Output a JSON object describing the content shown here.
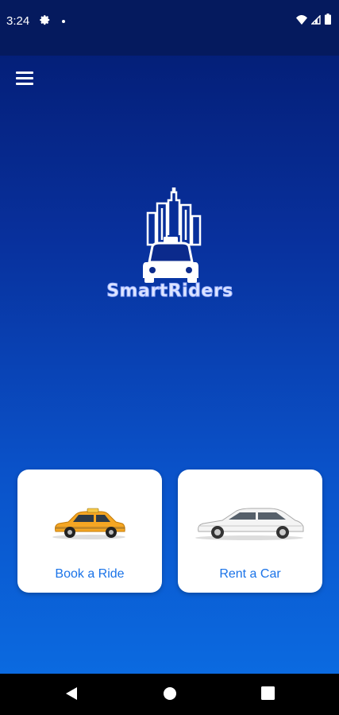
{
  "status_bar": {
    "time": "3:24",
    "icons": [
      "gear-icon",
      "notification-dot",
      "wifi-icon",
      "signal-icon",
      "battery-icon"
    ]
  },
  "header": {
    "menu_icon": "hamburger-menu-icon"
  },
  "logo": {
    "text": "SmartRiders",
    "icon": "city-taxi-logo"
  },
  "actions": [
    {
      "label": "Book a Ride",
      "icon": "taxi-icon"
    },
    {
      "label": "Rent a Car",
      "icon": "sedan-icon"
    }
  ],
  "nav": {
    "items": [
      "back-icon",
      "home-icon",
      "recents-icon"
    ]
  },
  "colors": {
    "status_bar": "#051a5e",
    "gradient_top": "#031a6e",
    "gradient_bottom": "#0b6ae0",
    "card_label": "#1a73e8",
    "taxi": "#f5a623"
  }
}
